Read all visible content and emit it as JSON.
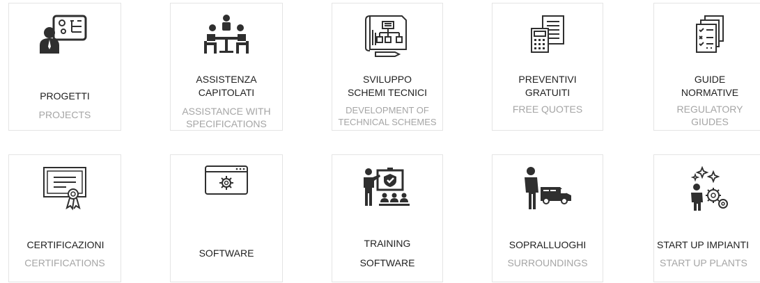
{
  "cards": [
    {
      "title": "PROGETTI",
      "subtitle": "PROJECTS",
      "icon": "project-manager-icon"
    },
    {
      "title": "ASSISTENZA\nCAPITOLATI",
      "subtitle": "ASSISTANCE WITH\nSPECIFICATIONS",
      "icon": "meeting-icon"
    },
    {
      "title": "SVILUPPO\nSCHEMI TECNICI",
      "subtitle": "DEVELOPMENT OF\nTECHNICAL SCHEMES",
      "icon": "blueprint-icon"
    },
    {
      "title": "PREVENTIVI\nGRATUITI",
      "subtitle": "FREE QUOTES",
      "icon": "calculator-document-icon"
    },
    {
      "title": "GUIDE\nNORMATIVE",
      "subtitle": "REGULATORY\nGIUDES",
      "icon": "checklist-icon"
    },
    {
      "title": "CERTIFICAZIONI",
      "subtitle": "CERTIFICATIONS",
      "icon": "certificate-icon"
    },
    {
      "title": "SOFTWARE",
      "subtitle": "",
      "icon": "software-window-icon"
    },
    {
      "title": "TRAINING",
      "subtitle": "SOFTWARE",
      "icon": "training-icon"
    },
    {
      "title": "SOPRALLUOGHI",
      "subtitle": "SURROUNDINGS",
      "icon": "technician-van-icon"
    },
    {
      "title": "START UP IMPIANTI",
      "subtitle": "START UP PLANTS",
      "icon": "startup-gears-icon"
    }
  ],
  "colors": {
    "icon": "#2f2f2f",
    "title": "#1f1f1f",
    "subtitle": "#a5a5a5",
    "border": "#e4e4e4"
  }
}
